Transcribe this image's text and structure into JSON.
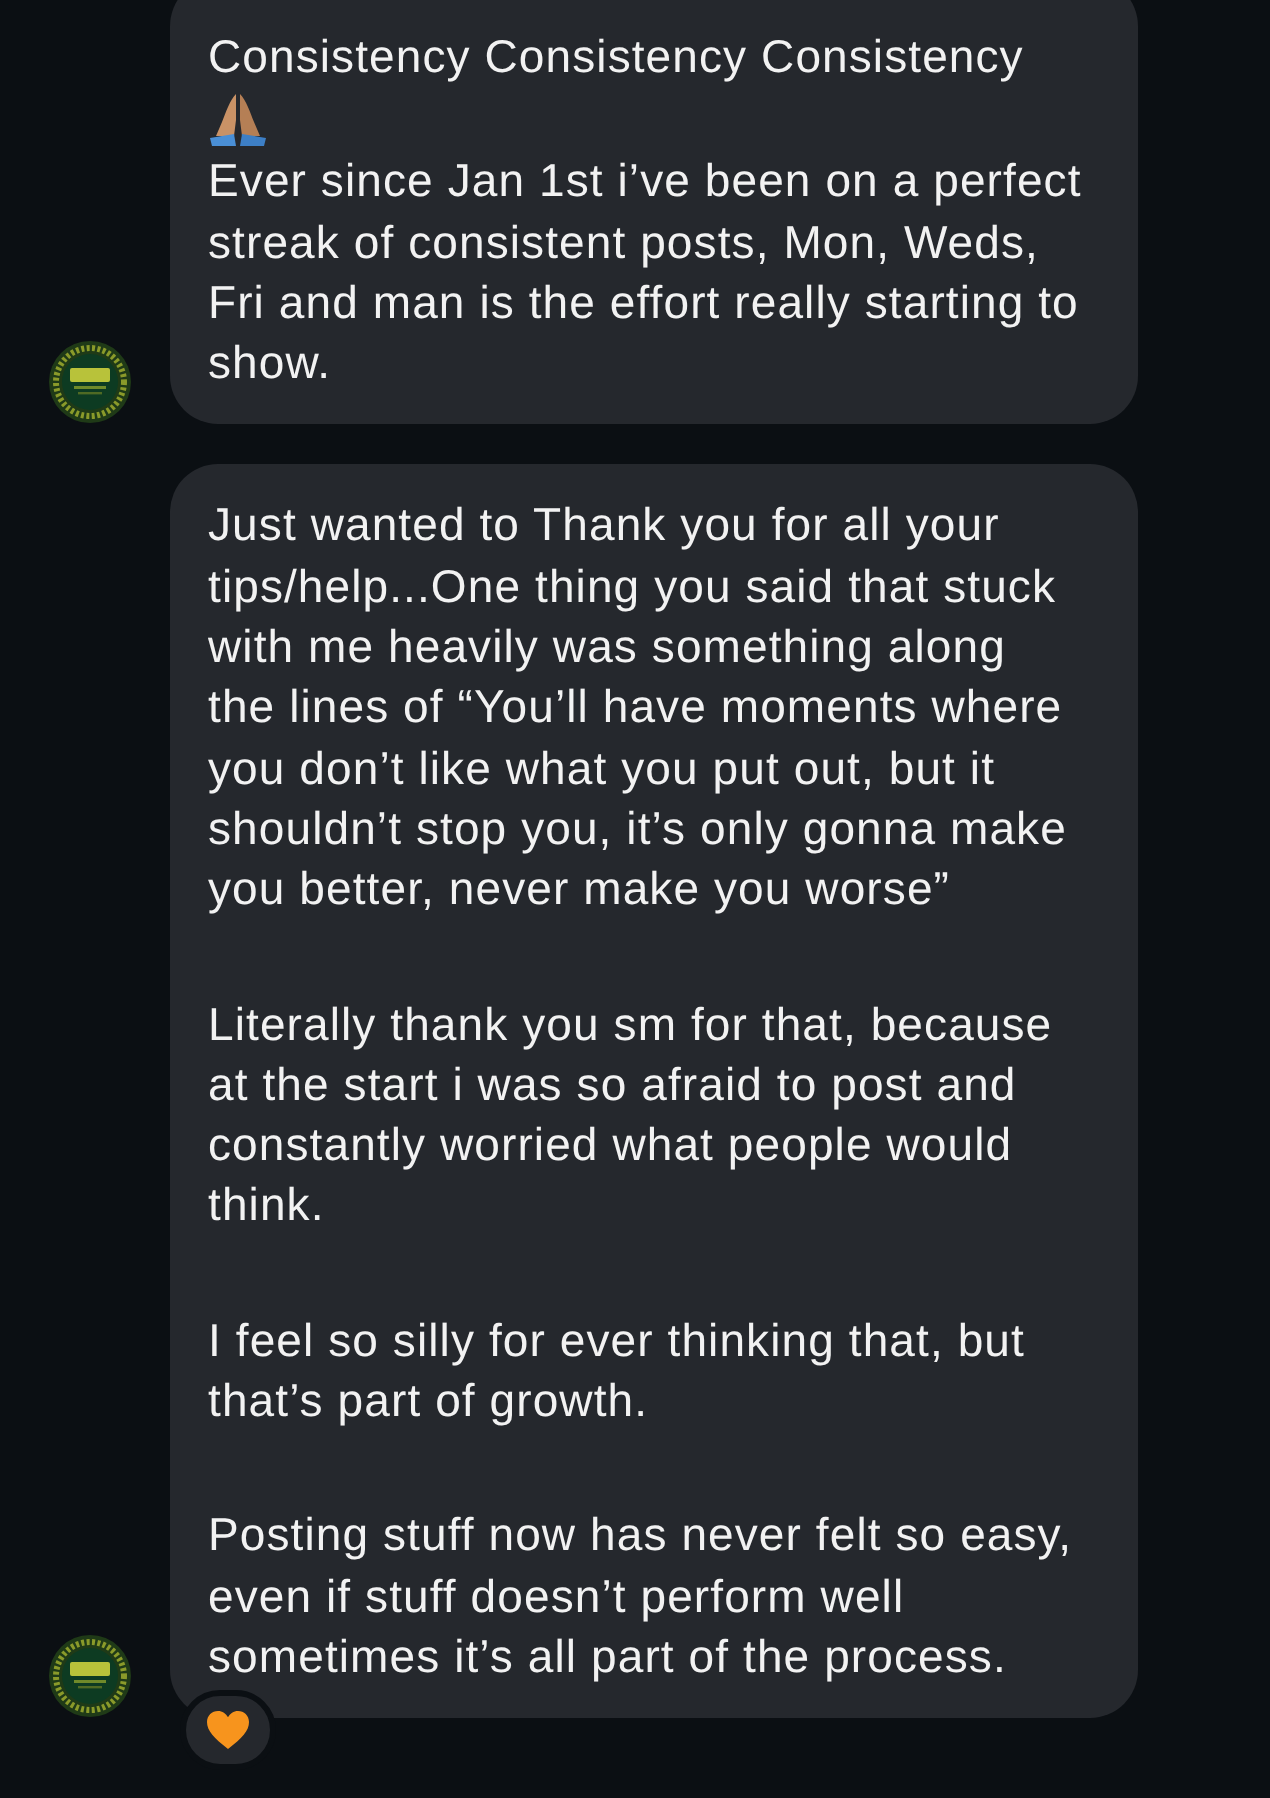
{
  "messages": [
    {
      "avatar": true,
      "blocks": [
        {
          "kind": "text",
          "text": "Consistency Consistency Consistency"
        },
        {
          "kind": "emoji"
        },
        {
          "kind": "text",
          "text": "Ever since Jan 1st i’ve been on a perfect streak of consistent posts, Mon, Weds, Fri and man is the effort really starting to show."
        }
      ]
    },
    {
      "avatar": true,
      "reacted": true,
      "paragraphs": [
        "Just wanted to Thank you for all your tips/help...One thing you said that stuck with me heavily was something along the lines of “You’ll have moments where you don’t like what you put out, but it shouldn’t stop you, it’s only gonna make you better, never make you worse”",
        "Literally thank you sm for that, because at the start i was so afraid to post and constantly worried what people would think.",
        "I feel so silly for ever thinking that, but that’s part of growth.",
        "Posting stuff now has never felt so easy, even if stuff doesn’t perform well sometimes it’s all part of the process."
      ]
    }
  ]
}
